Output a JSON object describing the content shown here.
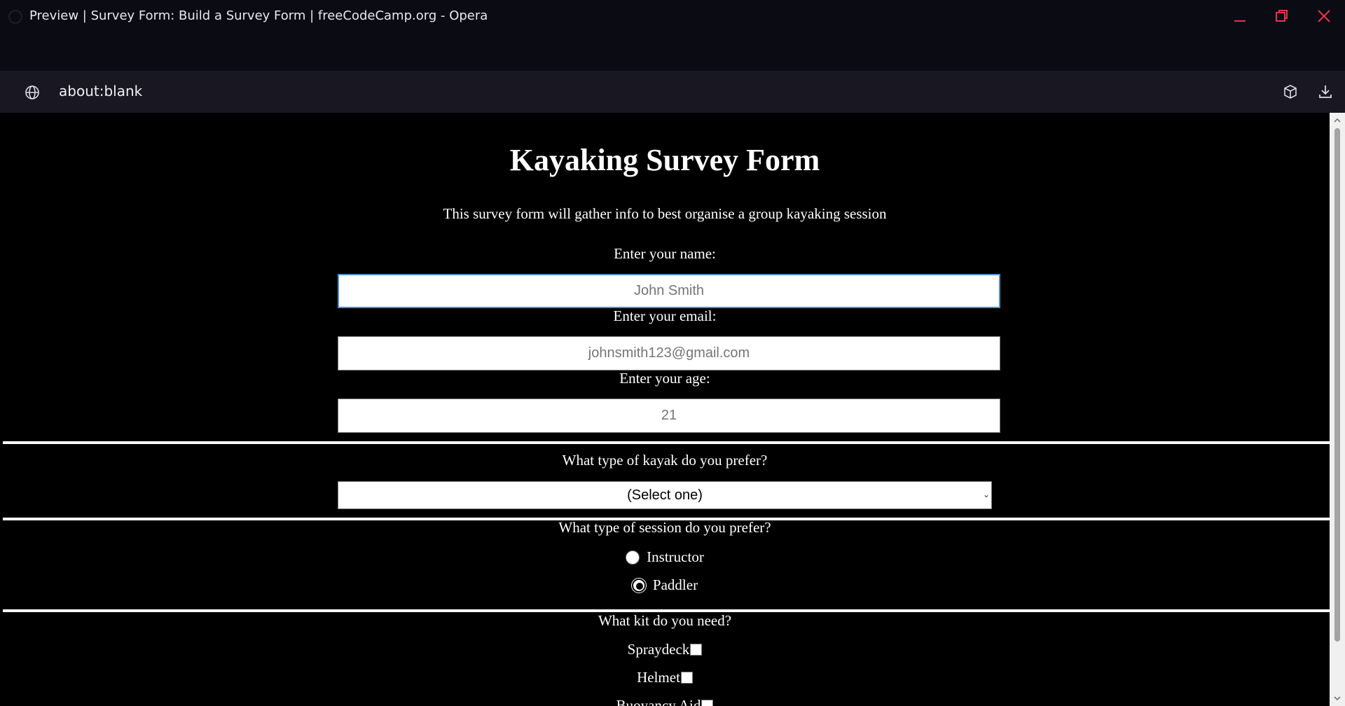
{
  "window": {
    "title": "Preview | Survey Form: Build a Survey Form | freeCodeCamp.org - Opera",
    "controls": [
      "minimize-icon",
      "restore-icon",
      "close-icon"
    ],
    "accent": "#e8334a"
  },
  "addressbar": {
    "url": "about:blank",
    "icons": [
      "globe-icon",
      "box-icon",
      "download-icon"
    ]
  },
  "page": {
    "heading": "Kayaking Survey Form",
    "description": "This survey form will gather info to best organise a group kayaking session",
    "name_label": "Enter your name:",
    "name_placeholder": "John Smith",
    "email_label": "Enter your email:",
    "email_placeholder": "johnsmith123@gmail.com",
    "age_label": "Enter your age:",
    "age_placeholder": "21",
    "kayak_question": "What type of kayak do you prefer?",
    "kayak_selected": "(Select one)",
    "session_question": "What type of session do you prefer?",
    "session_options": [
      {
        "label": "Instructor",
        "checked": false
      },
      {
        "label": "Paddler",
        "checked": true
      }
    ],
    "kit_question": "What kit do you need?",
    "kit_options": [
      "Spraydeck",
      "Helmet",
      "Buoyancy Aid"
    ]
  }
}
